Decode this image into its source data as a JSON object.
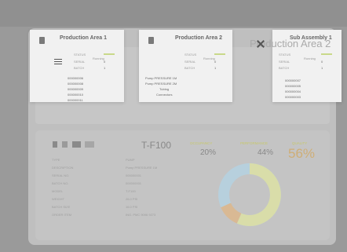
{
  "cards": [
    {
      "title": "Production Area 1",
      "status_label": "STATUS",
      "status_text": "Running",
      "rows": [
        [
          "SERIAL",
          "0"
        ],
        [
          "BATCH",
          "1"
        ]
      ],
      "list": [
        "000000006",
        "000000008",
        "000000009",
        "000000010",
        "000000011"
      ]
    },
    {
      "title": "Production Area 2",
      "status_label": "STATUS",
      "status_text": "Running",
      "rows": [
        [
          "SERIAL",
          "0"
        ],
        [
          "BATCH",
          "1"
        ]
      ],
      "list": [
        "Pump PRESSURE 1M",
        "Pump PRESSURE 2M",
        "Tubing",
        "Connectors"
      ]
    },
    {
      "title": "Sub Assembly 1",
      "status_label": "STATUS",
      "status_text": "Running",
      "rows": [
        [
          "SERIAL",
          "0"
        ],
        [
          "BATCH",
          "1"
        ]
      ],
      "list": [
        "000000007",
        "000000005",
        "000000004",
        "000000003"
      ]
    }
  ],
  "overlay_title": "Production Area 2",
  "lower": {
    "device": "T-F100",
    "headers": [
      "OCCUPANCY",
      "PERFORMANCE",
      "QUALITY"
    ],
    "occupancy": "20%",
    "performance": "44%",
    "quality": "56%",
    "detail_labels": [
      "TYPE",
      "DESCRIPTION",
      "SERIAL NO.",
      "BATCH NO.",
      "MODEL",
      "WEIGHT",
      "BATCH SIZE",
      "ORDER ITEM"
    ],
    "detail_values": [
      "PUMP",
      "Pump PRESSURE 1M",
      "000000001",
      "000000001",
      "T-F100",
      "26.0 PSI",
      "16.0 PSI",
      "ING. PMC 9096 9273"
    ]
  }
}
